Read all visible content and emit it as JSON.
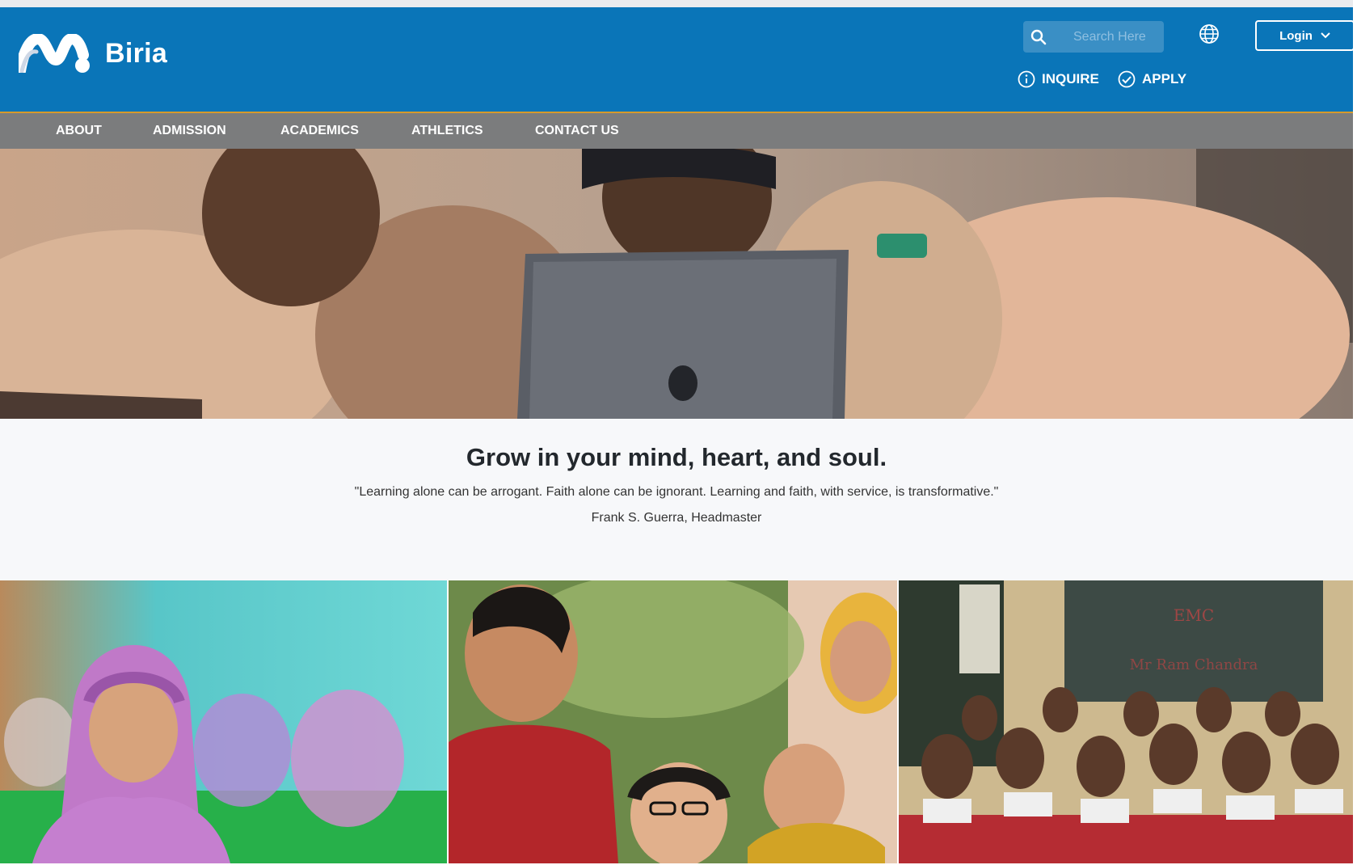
{
  "brand": {
    "name": "Biria"
  },
  "search": {
    "placeholder": "Search Here"
  },
  "header": {
    "login_label": "Login",
    "inquire_label": "INQUIRE",
    "apply_label": "APPLY"
  },
  "nav": {
    "items": [
      {
        "label": "ABOUT"
      },
      {
        "label": "ADMISSION"
      },
      {
        "label": "ACADEMICS"
      },
      {
        "label": "ATHLETICS"
      },
      {
        "label": "CONTACT US"
      }
    ]
  },
  "hero": {
    "alt": "Students in uniforms gathered around a laptop"
  },
  "tagline": {
    "heading": "Grow in your mind, heart, and soul.",
    "quote": "\"Learning alone can be arrogant. Faith alone can be ignorant. Learning and faith, with service, is transformative.\"",
    "author": "Frank S. Guerra, Headmaster"
  },
  "colors": {
    "header_bg": "#0a75b8",
    "nav_bg": "#7b7c7d",
    "accent_line": "#d59a2c"
  },
  "icons": {
    "search": "search-icon",
    "globe": "globe-icon",
    "chevron": "chevron-down-icon",
    "info": "info-icon",
    "check": "check-circle-icon"
  }
}
